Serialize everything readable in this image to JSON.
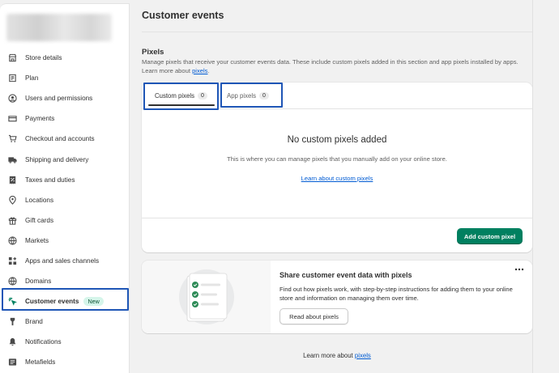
{
  "sidebar": {
    "items": [
      {
        "label": "Store details",
        "icon": "store-icon"
      },
      {
        "label": "Plan",
        "icon": "plan-icon"
      },
      {
        "label": "Users and permissions",
        "icon": "user-icon"
      },
      {
        "label": "Payments",
        "icon": "credit-card-icon"
      },
      {
        "label": "Checkout and accounts",
        "icon": "cart-icon"
      },
      {
        "label": "Shipping and delivery",
        "icon": "truck-icon"
      },
      {
        "label": "Taxes and duties",
        "icon": "receipt-icon"
      },
      {
        "label": "Locations",
        "icon": "location-icon"
      },
      {
        "label": "Gift cards",
        "icon": "gift-icon"
      },
      {
        "label": "Markets",
        "icon": "globe-icon"
      },
      {
        "label": "Apps and sales channels",
        "icon": "apps-icon"
      },
      {
        "label": "Domains",
        "icon": "domain-icon"
      },
      {
        "label": "Customer events",
        "icon": "cursor-sparkle-icon",
        "badge": "New",
        "active": true
      },
      {
        "label": "Brand",
        "icon": "brand-icon"
      },
      {
        "label": "Notifications",
        "icon": "bell-icon"
      },
      {
        "label": "Metafields",
        "icon": "metafields-icon"
      }
    ]
  },
  "page": {
    "title": "Customer events"
  },
  "pixels": {
    "heading": "Pixels",
    "description": "Manage pixels that receive your customer events data. These include custom pixels added in this section and app pixels installed by apps. Learn more about ",
    "description_link": "pixels",
    "description_end": ".",
    "tabs": [
      {
        "label": "Custom pixels",
        "count": "0",
        "selected": true
      },
      {
        "label": "App pixels",
        "count": "0",
        "selected": false
      }
    ],
    "empty_title": "No custom pixels added",
    "empty_description": "This is where you can manage pixels that you manually add on your online store.",
    "empty_link": "Learn about custom pixels",
    "add_button": "Add custom pixel"
  },
  "share": {
    "title": "Share customer event data with pixels",
    "description": "Find out how pixels work, with step-by-step instructions for adding them to your online store and information on managing them over time.",
    "button": "Read about pixels",
    "menu_icon": "more-horizontal-icon"
  },
  "footer": {
    "text": "Learn more about ",
    "link": "pixels"
  },
  "colors": {
    "primary": "#008060",
    "highlight": "#1f56b6",
    "link": "#005bd3",
    "badge_bg": "#d5f5ea"
  }
}
